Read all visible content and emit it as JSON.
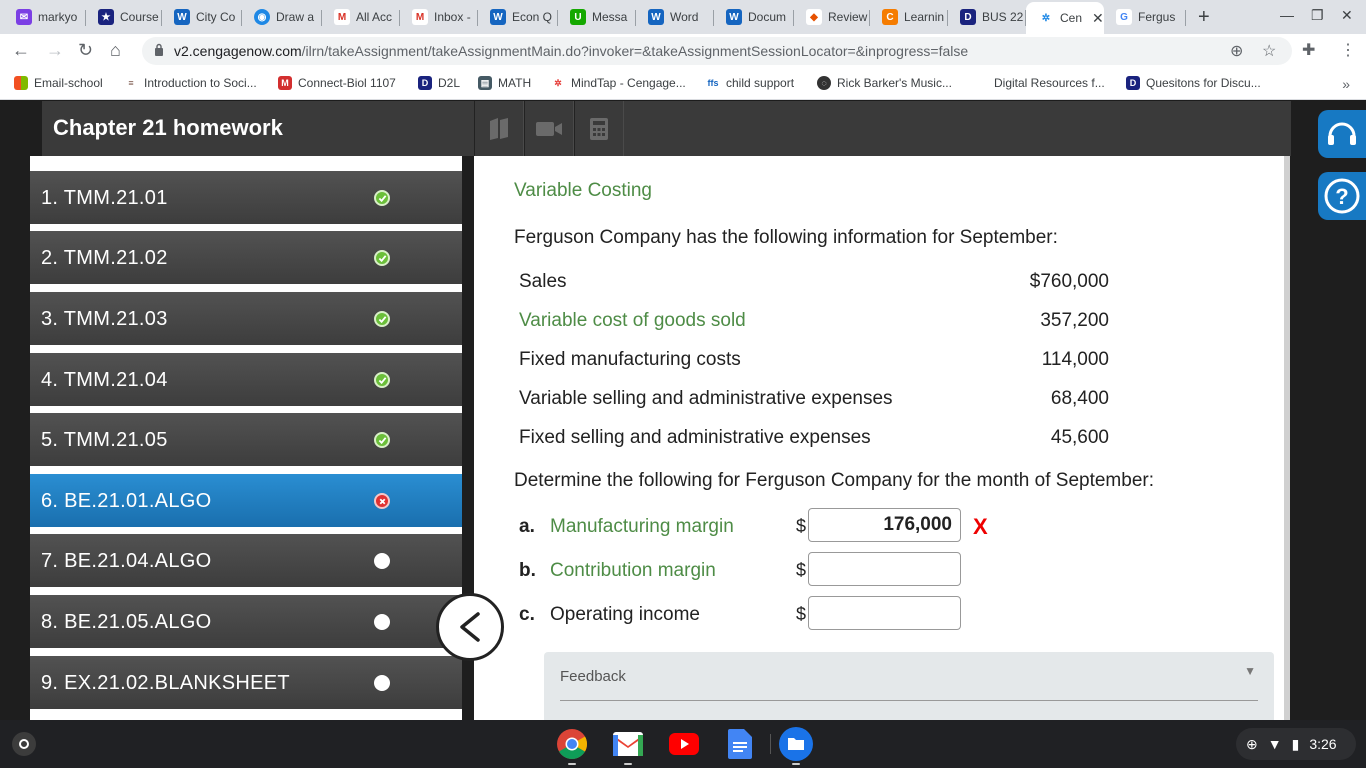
{
  "browser": {
    "tabs": [
      {
        "label": "markyo",
        "icon": "email-icon",
        "color": "#7b3fe4"
      },
      {
        "label": "Course",
        "icon": "star-badge-icon",
        "color": "#1a237e"
      },
      {
        "label": "City Co",
        "icon": "word-doc-icon",
        "color": "#1565c0"
      },
      {
        "label": "Draw a",
        "icon": "globe-icon",
        "color": "#1e88e5"
      },
      {
        "label": "All Acc",
        "icon": "gmail-icon",
        "color": "#d93025"
      },
      {
        "label": "Inbox -",
        "icon": "gmail-icon",
        "color": "#d93025"
      },
      {
        "label": "Econ Q",
        "icon": "word-doc-icon",
        "color": "#1565c0"
      },
      {
        "label": "Messa",
        "icon": "upwork-icon",
        "color": "#14a800"
      },
      {
        "label": "Word",
        "icon": "word-doc-icon",
        "color": "#1565c0"
      },
      {
        "label": "Docum",
        "icon": "word-doc-icon",
        "color": "#1565c0"
      },
      {
        "label": "Review",
        "icon": "flame-icon",
        "color": "#e65100"
      },
      {
        "label": "Learnin",
        "icon": "c-logo-icon",
        "color": "#f57c00"
      },
      {
        "label": "BUS 22",
        "icon": "d2l-icon",
        "color": "#1a237e"
      },
      {
        "label": "Cen",
        "icon": "cengage-icon",
        "color": "#1e88e5"
      },
      {
        "label": "Fergus",
        "icon": "google-icon",
        "color": "#4285f4"
      }
    ],
    "url_host": "v2.cengagenow.com",
    "url_path": "/ilrn/takeAssignment/takeAssignmentMain.do?invoker=&takeAssignmentSessionLocator=&inprogress=false",
    "bookmarks": [
      {
        "label": "Email-school",
        "icon": "windows-icon",
        "color": "#f25022"
      },
      {
        "label": "Introduction to Soci...",
        "icon": "book-icon",
        "color": "#795548"
      },
      {
        "label": "Connect-Biol 1107",
        "icon": "mcgraw-icon",
        "color": "#d32f2f"
      },
      {
        "label": "D2L",
        "icon": "d2l-icon",
        "color": "#1a237e"
      },
      {
        "label": "MATH",
        "icon": "doc-icon",
        "color": "#455a64"
      },
      {
        "label": "MindTap - Cengage...",
        "icon": "cengage-icon",
        "color": "#e53935"
      },
      {
        "label": "child support",
        "icon": "agency-icon",
        "color": "#1565c0"
      },
      {
        "label": "Rick Barker's Music...",
        "icon": "globe-icon",
        "color": "#333333"
      },
      {
        "label": "Digital Resources f...",
        "icon": "",
        "color": "#ffffff"
      },
      {
        "label": "Quesitons for Discu...",
        "icon": "d2l-icon",
        "color": "#1a237e"
      }
    ]
  },
  "assignment": {
    "title": "Chapter 21 homework",
    "questions": [
      {
        "label": "1. TMM.21.01",
        "status": "correct"
      },
      {
        "label": "2. TMM.21.02",
        "status": "correct"
      },
      {
        "label": "3. TMM.21.03",
        "status": "correct"
      },
      {
        "label": "4. TMM.21.04",
        "status": "correct"
      },
      {
        "label": "5. TMM.21.05",
        "status": "correct"
      },
      {
        "label": "6. BE.21.01.ALGO",
        "status": "wrong"
      },
      {
        "label": "7. BE.21.04.ALGO",
        "status": "unanswered"
      },
      {
        "label": "8. BE.21.05.ALGO",
        "status": "unanswered"
      },
      {
        "label": "9. EX.21.02.BLANKSHEET",
        "status": "unanswered"
      }
    ],
    "active_question": 6
  },
  "problem": {
    "title": "Variable Costing",
    "intro": "Ferguson Company has the following information for September:",
    "rows": [
      {
        "label": "Sales",
        "value": "$760,000"
      },
      {
        "label": "Variable cost of goods sold",
        "value": "357,200"
      },
      {
        "label": "Fixed manufacturing costs",
        "value": "114,000"
      },
      {
        "label": "Variable selling and administrative expenses",
        "value": "68,400"
      },
      {
        "label": "Fixed selling and administrative expenses",
        "value": "45,600"
      }
    ],
    "determine": "Determine the following for Ferguson Company for the month of September:",
    "answers": [
      {
        "letter": "a.",
        "label": "Manufacturing margin",
        "currency": "$",
        "value": "176,000",
        "mark": "X"
      },
      {
        "letter": "b.",
        "label": "Contribution margin",
        "currency": "$",
        "value": "",
        "mark": ""
      },
      {
        "letter": "c.",
        "label": "Operating income",
        "currency": "$",
        "value": "",
        "mark": ""
      }
    ],
    "feedback_label": "Feedback"
  },
  "shelf": {
    "time": "3:26",
    "apps": [
      "chrome-icon",
      "gmail-icon",
      "youtube-icon",
      "docs-icon",
      "files-icon"
    ]
  },
  "colors": {
    "accent_green": "#4e8c46",
    "active_question_blue": "#1f7fc2",
    "correct_green": "#6bbf3a",
    "wrong_red": "#e03131"
  }
}
